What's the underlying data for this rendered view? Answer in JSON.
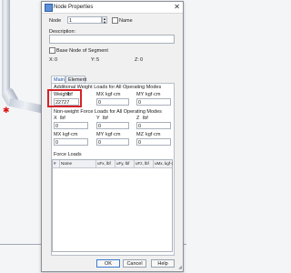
{
  "window": {
    "title": "Node Properties",
    "close_glyph": "✕"
  },
  "node": {
    "label": "Node",
    "value": "1",
    "name_label": "Name"
  },
  "description": {
    "label": "Description:"
  },
  "base_node": {
    "label": "Base Node of Segment"
  },
  "coords": {
    "x_label": "X:",
    "x_value": "0",
    "y_label": "Y:",
    "y_value": "5",
    "z_label": "Z:",
    "z_value": "0"
  },
  "tabs": [
    {
      "label": "Main"
    },
    {
      "label": "Element"
    }
  ],
  "additional_weight": {
    "heading": "Additional Weight Loads for All Operating Modes",
    "weight_label": "Weight",
    "weight_unit": "lbf",
    "weight_value": "22727",
    "mx_label": "MX",
    "mx_unit": "kgf·cm",
    "mx_value": "0",
    "my_label": "MY",
    "my_unit": "kgf·cm",
    "my_value": "0"
  },
  "nonweight": {
    "heading": "Non-weight Force Loads for All Operating Modes",
    "x_label": "X",
    "x_unit": "lbf",
    "x_value": "0",
    "y_label": "Y",
    "y_unit": "lbf",
    "y_value": "0",
    "z_label": "Z",
    "z_unit": "lbf",
    "z_value": "0",
    "mx_label": "MX",
    "mx_unit": "kgf·cm",
    "mx_value": "0",
    "my_label": "MY",
    "my_unit": "kgf·cm",
    "my_value": "0",
    "mz_label": "MZ",
    "mz_unit": "kgf·cm",
    "mz_value": "0"
  },
  "force_loads": {
    "heading": "Force Loads",
    "columns": [
      "#",
      "Name",
      "uFx, lbf",
      "uFy, lbf",
      "uFz, lbf",
      "uMx, kgf·cm"
    ]
  },
  "buttons": {
    "ok": "OK",
    "cancel": "Cancel",
    "help": "Help"
  },
  "colors": {
    "highlight": "#d4242a",
    "tab_active_text": "#1a4fa0",
    "node_marker": "#dd1111"
  }
}
